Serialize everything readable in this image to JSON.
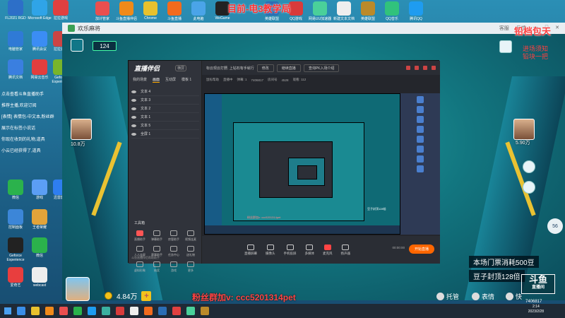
{
  "topbar": {
    "title": "目前-电3教学局",
    "icons": [
      {
        "label": "加计管家",
        "color": "#e94f4f"
      },
      {
        "label": "斗鱼直播伴侣",
        "color": "#f08a1a"
      },
      {
        "label": "Chrome",
        "color": "#e8c12e"
      },
      {
        "label": "斗鱼直播",
        "color": "#f26b1d"
      },
      {
        "label": "此电脑",
        "color": "#4aa4e8"
      },
      {
        "label": "WeGame",
        "color": "#222"
      },
      {
        "label": "英雄联盟",
        "color": "#2b6db4"
      },
      {
        "label": "QQ游戏",
        "color": "#d83b3b"
      },
      {
        "label": "网易UU加速器",
        "color": "#4ad09a"
      },
      {
        "label": "新建文本文档",
        "color": "#eee"
      },
      {
        "label": "英雄联盟",
        "color": "#bb8a2a"
      },
      {
        "label": "QQ音乐",
        "color": "#31c27c"
      },
      {
        "label": "腾讯QQ",
        "color": "#1e9cf0"
      }
    ]
  },
  "desktop_left": [
    {
      "label": "FL2021 RGD",
      "color": "#2d6fc8"
    },
    {
      "label": "Microsoft Edge",
      "color": "#2fa4e8"
    },
    {
      "label": "拉拉游戏",
      "color": "#e04040"
    },
    {
      "label": "电脑管家",
      "color": "#2f7ad6"
    },
    {
      "label": "腾讯会议",
      "color": "#3b8df4"
    },
    {
      "label": "拉拉游戏",
      "color": "#cc4444"
    },
    {
      "label": "腾讯文档",
      "color": "#3a7fe0"
    },
    {
      "label": "网易云音乐",
      "color": "#e23e3e"
    },
    {
      "label": "Geforce Experience",
      "color": "#78b52b"
    },
    {
      "label": "微信",
      "color": "#2bb24c"
    },
    {
      "label": "游戏",
      "color": "#5b9ef5"
    },
    {
      "label": "迅雷影音",
      "color": "#2e7ef0"
    },
    {
      "label": "控制面板",
      "color": "#3c86d8"
    },
    {
      "label": "王者荣耀",
      "color": "#e2a33a"
    },
    {
      "label": "Geforce Experience",
      "color": "#222"
    },
    {
      "label": "微信",
      "color": "#2bb24c"
    },
    {
      "label": "爱奇艺",
      "color": "#e83e3e"
    },
    {
      "label": "webcast",
      "color": "#eeeeee"
    }
  ],
  "left_notes": [
    "点击查看斗鱼直播助手",
    "推荐主播,欢迎订阅",
    "[表情] 表情包-中文本,粉丝群",
    "展示在标签小说话",
    "你现在收到的礼物,道具",
    "小云已经获得了,道具"
  ],
  "game": {
    "window_title": "欢乐麻将",
    "ctrl_labels": [
      "客服",
      "反馈",
      "—",
      "□",
      "✕"
    ],
    "badge": "124",
    "right_red_big": "铅档包天",
    "right_red_small1": "进场须知",
    "right_red_small2": "铅块一把",
    "left_player_score": "10.8万",
    "right_player_score": "5.90万",
    "cost_line1": "本场门票消耗500豆",
    "cost_line2": "豆子封顶128倍",
    "coins": "4.84万",
    "plus": "+",
    "fan_note": "粉丝群加v: ccc5201314pet",
    "buttons": [
      "托管",
      "表情",
      "快"
    ],
    "round": "56",
    "watermark_big": "斗鱼",
    "watermark_small": "直播间",
    "watermark_id": "7406817"
  },
  "stream": {
    "logo": "直播伴侣",
    "logo_tag": "横屏",
    "tabs": [
      "我的场景",
      "画面",
      "互动屏",
      "模板 1"
    ],
    "scenes": [
      "文本 4",
      "文本 3",
      "文本 2",
      "文本 1",
      "文本 5",
      "全屏 1"
    ],
    "tools_title": "工具箱",
    "tools": [
      "直播助手",
      "弹幕助手",
      "房管助手",
      "视频连麦",
      "人人连屏",
      "赛事助手",
      "任务中心",
      "送礼物",
      "虚拟形象",
      "抽奖",
      "游戏",
      "更多"
    ],
    "bottom_note": "斗鱼直播伴侣帮助助手",
    "head_title": "标云现云打野, 上钻石有手就行",
    "head_pill": "修改",
    "head_pill2": "继续直播",
    "head_pill3": "查询PK入场介绍",
    "sub_info": [
      "鼠标帮助",
      "直播中",
      "弹幕: 1",
      "7406817",
      "房间号",
      "4528",
      "观看: 112"
    ],
    "bar_buttons": [
      "直播屏幕",
      "摄像头",
      "手机投屏",
      "多媒体",
      "麦克风",
      "扬声器"
    ],
    "bar_info": "00:00:00",
    "go_live": "开始直播",
    "preview_texts": [
      "粉丝群加v: ccc5201314pet",
      "豆子封顶128倍"
    ]
  },
  "taskbar": {
    "time": "2:14",
    "date": "2023/2/28"
  }
}
